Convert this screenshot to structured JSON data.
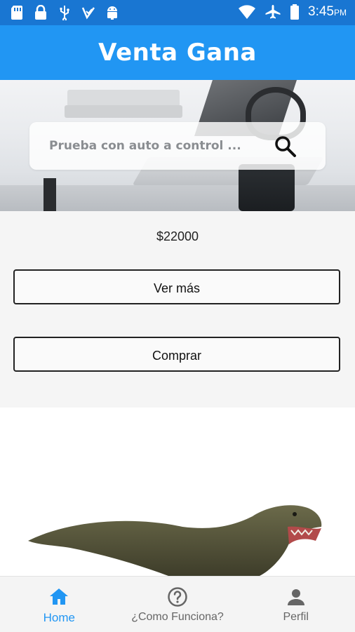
{
  "status_bar": {
    "time": "3:45",
    "ampm": "PM",
    "icons": [
      "sd-card-icon",
      "lock-icon",
      "usb-icon",
      "inbox-check-icon",
      "android-icon",
      "wifi-icon",
      "airplane-icon",
      "battery-icon"
    ]
  },
  "app_bar": {
    "title": "Venta Gana"
  },
  "search": {
    "placeholder": "Prueba con auto a control ..."
  },
  "product": {
    "price": "$22000",
    "more_label": "Ver más",
    "buy_label": "Comprar"
  },
  "bottom_nav": {
    "items": [
      {
        "label": "Home",
        "icon": "home-icon",
        "active": true
      },
      {
        "label": "¿Como Funciona?",
        "icon": "help-circle-icon",
        "active": false
      },
      {
        "label": "Perfil",
        "icon": "person-icon",
        "active": false
      }
    ]
  },
  "colors": {
    "status_bar": "#1976d2",
    "app_bar": "#2196f3",
    "accent": "#2196f3",
    "inactive": "#666666"
  }
}
